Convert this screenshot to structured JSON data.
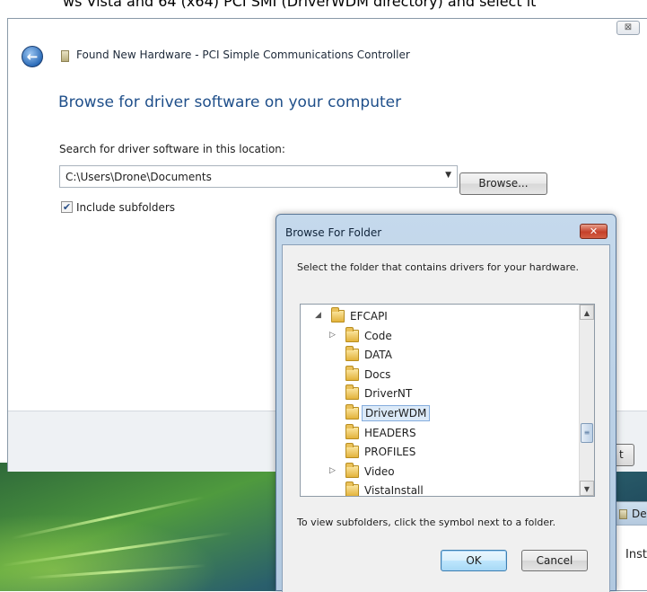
{
  "top_strip": {
    "cut_text": "ws Vista and 64 (x64) PCI SMI (DriverWDM directory) and select it"
  },
  "wizard": {
    "close_glyph": "⊠",
    "back_glyph": "←",
    "title": "Found New Hardware - PCI Simple Communications Controller",
    "heading": "Browse for driver software on your computer",
    "search_label": "Search for driver software in this location:",
    "path_value": "C:\\Users\\Drone\\Documents",
    "dropdown_glyph": "▼",
    "browse_button": "Browse...",
    "include_checked_glyph": "✔",
    "include_label": "Include subfolders",
    "footer_partial_button": "t"
  },
  "second_window": {
    "title_fragment": "De",
    "body_fragment": "Inst"
  },
  "browse_dialog": {
    "title": "Browse For Folder",
    "close_glyph": "✕",
    "instruction": "Select the folder that contains drivers for your hardware.",
    "tree": [
      {
        "name": "EFCAPI",
        "expander": "◢",
        "level": 0,
        "selected": false
      },
      {
        "name": "Code",
        "expander": "▷",
        "level": 1,
        "selected": false
      },
      {
        "name": "DATA",
        "expander": "",
        "level": 1,
        "selected": false
      },
      {
        "name": "Docs",
        "expander": "",
        "level": 1,
        "selected": false
      },
      {
        "name": "DriverNT",
        "expander": "",
        "level": 1,
        "selected": false
      },
      {
        "name": "DriverWDM",
        "expander": "",
        "level": 1,
        "selected": true
      },
      {
        "name": "HEADERS",
        "expander": "",
        "level": 1,
        "selected": false
      },
      {
        "name": "PROFILES",
        "expander": "",
        "level": 1,
        "selected": false
      },
      {
        "name": "Video",
        "expander": "▷",
        "level": 1,
        "selected": false
      },
      {
        "name": "VistaInstall",
        "expander": "",
        "level": 1,
        "selected": false
      }
    ],
    "scroll_up_glyph": "▲",
    "scroll_down_glyph": "▼",
    "scroll_thumb_glyph": "≡",
    "note": "To view subfolders, click the symbol next to a folder.",
    "ok_button": "OK",
    "cancel_button": "Cancel"
  }
}
